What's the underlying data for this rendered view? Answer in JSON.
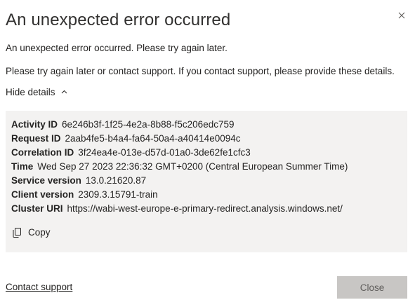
{
  "dialog": {
    "title": "An unexpected error occurred",
    "message": "An unexpected error occurred. Please try again later.",
    "instructions": "Please try again later or contact support. If you contact support, please provide these details.",
    "toggle_label": "Hide details",
    "details": [
      {
        "key": "Activity ID",
        "value": "6e246b3f-1f25-4e2a-8b88-f5c206edc759"
      },
      {
        "key": "Request ID",
        "value": "2aab4fe5-b4a4-fa64-50a4-a40414e0094c"
      },
      {
        "key": "Correlation ID",
        "value": "3f24ea4e-013e-d57d-01a0-3de62fe1cfc3"
      },
      {
        "key": "Time",
        "value": "Wed Sep 27 2023 22:36:32 GMT+0200 (Central European Summer Time)"
      },
      {
        "key": "Service version",
        "value": "13.0.21620.87"
      },
      {
        "key": "Client version",
        "value": "2309.3.15791-train"
      },
      {
        "key": "Cluster URI",
        "value": "https://wabi-west-europe-e-primary-redirect.analysis.windows.net/"
      }
    ],
    "copy_label": "Copy",
    "contact_label": "Contact support",
    "close_label": "Close",
    "icons": {
      "close": "close-icon",
      "toggle": "chevron-up-icon",
      "copy": "copy-icon"
    },
    "colors": {
      "details_bg": "#f3f2f1",
      "close_button_bg": "#c8c6c4",
      "text": "#252423"
    }
  }
}
